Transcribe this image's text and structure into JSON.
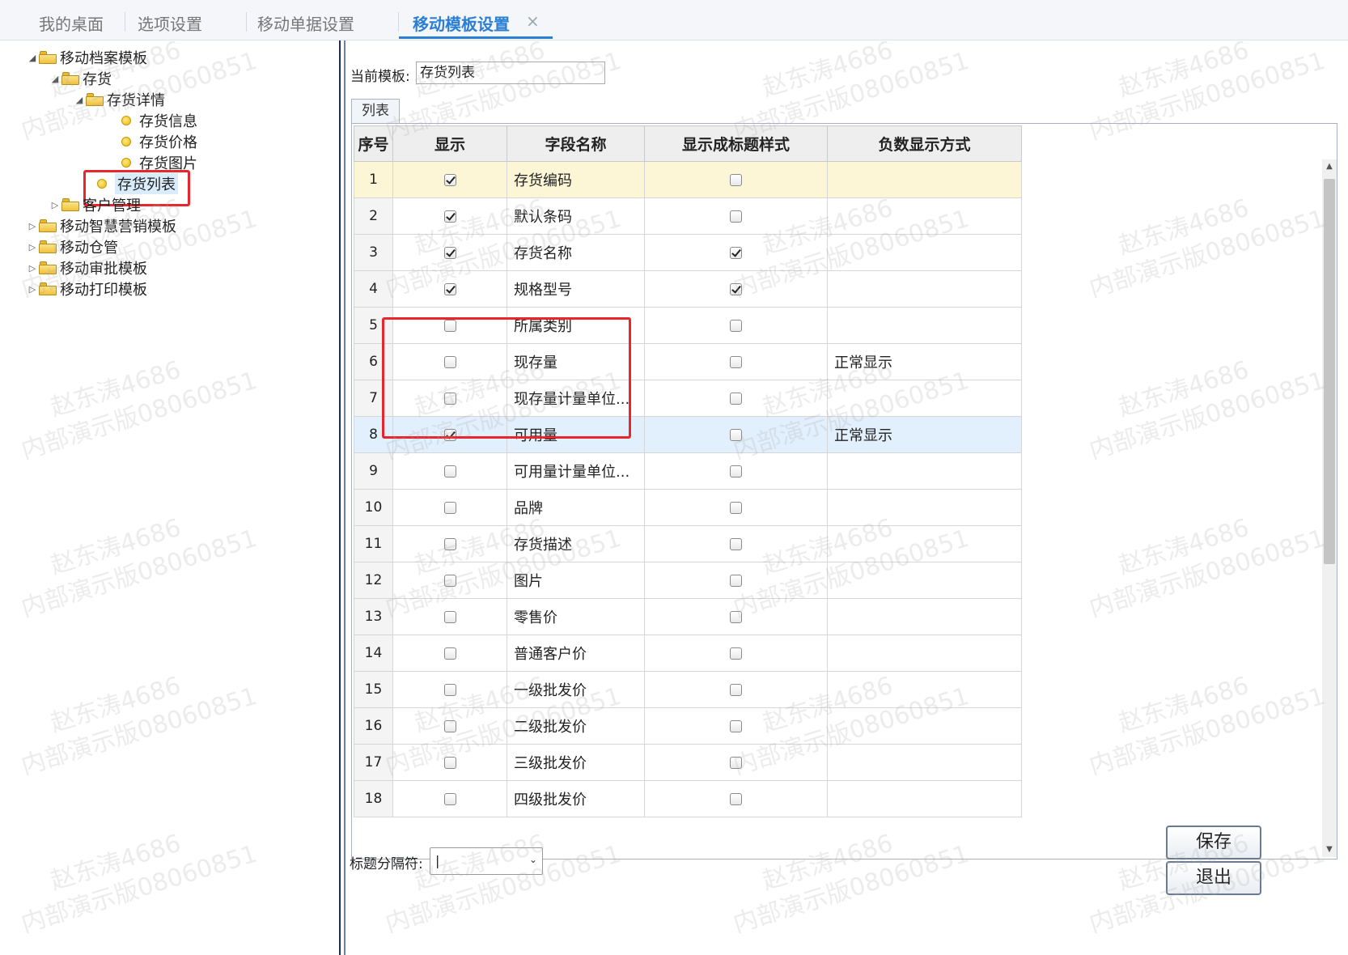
{
  "tabs": [
    {
      "label": "我的桌面"
    },
    {
      "label": "选项设置"
    },
    {
      "label": "移动单据设置"
    },
    {
      "label": "移动模板设置"
    }
  ],
  "tab_close": "×",
  "tree": [
    {
      "label": "移动档案模板"
    },
    {
      "label": "存货"
    },
    {
      "label": "存货详情"
    },
    {
      "label": "存货信息"
    },
    {
      "label": "存货价格"
    },
    {
      "label": "存货图片"
    },
    {
      "label": "存货列表"
    },
    {
      "label": "客户管理"
    },
    {
      "label": "移动智慧营销模板"
    },
    {
      "label": "移动仓管"
    },
    {
      "label": "移动审批模板"
    },
    {
      "label": "移动打印模板"
    }
  ],
  "current_template_label": "当前模板:",
  "current_template_value": "存货列表",
  "list_tab": "列表",
  "columns": [
    "序号",
    "显示",
    "字段名称",
    "显示成标题样式",
    "负数显示方式"
  ],
  "rows": [
    {
      "no": "1",
      "show": true,
      "name": "存货编码",
      "title_style": false,
      "negative": ""
    },
    {
      "no": "2",
      "show": true,
      "name": "默认条码",
      "title_style": false,
      "negative": ""
    },
    {
      "no": "3",
      "show": true,
      "name": "存货名称",
      "title_style": true,
      "negative": ""
    },
    {
      "no": "4",
      "show": true,
      "name": "规格型号",
      "title_style": true,
      "negative": ""
    },
    {
      "no": "5",
      "show": false,
      "name": "所属类别",
      "title_style": false,
      "negative": ""
    },
    {
      "no": "6",
      "show": false,
      "name": "现存量",
      "title_style": false,
      "negative": "正常显示"
    },
    {
      "no": "7",
      "show": false,
      "name": "现存量计量单位...",
      "title_style": false,
      "negative": ""
    },
    {
      "no": "8",
      "show": true,
      "name": "可用量",
      "title_style": false,
      "negative": "正常显示"
    },
    {
      "no": "9",
      "show": false,
      "name": "可用量计量单位...",
      "title_style": false,
      "negative": ""
    },
    {
      "no": "10",
      "show": false,
      "name": "品牌",
      "title_style": false,
      "negative": ""
    },
    {
      "no": "11",
      "show": false,
      "name": "存货描述",
      "title_style": false,
      "negative": ""
    },
    {
      "no": "12",
      "show": false,
      "name": "图片",
      "title_style": false,
      "negative": ""
    },
    {
      "no": "13",
      "show": false,
      "name": "零售价",
      "title_style": false,
      "negative": ""
    },
    {
      "no": "14",
      "show": false,
      "name": "普通客户价",
      "title_style": false,
      "negative": ""
    },
    {
      "no": "15",
      "show": false,
      "name": "一级批发价",
      "title_style": false,
      "negative": ""
    },
    {
      "no": "16",
      "show": false,
      "name": "二级批发价",
      "title_style": false,
      "negative": ""
    },
    {
      "no": "17",
      "show": false,
      "name": "三级批发价",
      "title_style": false,
      "negative": ""
    },
    {
      "no": "18",
      "show": false,
      "name": "四级批发价",
      "title_style": false,
      "negative": ""
    }
  ],
  "separator_label": "标题分隔符:",
  "separator_value": "|",
  "save_label": "保存",
  "exit_label": "退出",
  "watermark": {
    "name": "赵东涛4686",
    "org": "内部演示版08060851"
  }
}
